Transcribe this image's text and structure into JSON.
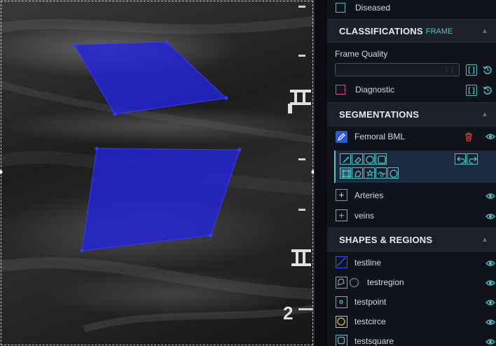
{
  "panel": {
    "top_item": {
      "label": "Diseased"
    },
    "classifications": {
      "title": "CLASSIFICATIONS",
      "tag": "FRAME",
      "frame_quality_label": "Frame Quality",
      "frame_quality_value": "",
      "diagnostic_label": "Diagnostic",
      "bracket_label": "[ ]"
    },
    "segmentations": {
      "title": "SEGMENTATIONS",
      "active_item": {
        "label": "Femoral BML"
      },
      "items": [
        {
          "label": "Arteries"
        },
        {
          "label": "veins"
        }
      ]
    },
    "shapes": {
      "title": "SHAPES & REGIONS",
      "items": [
        {
          "label": "testline",
          "type": "line"
        },
        {
          "label": "testregion",
          "type": "region"
        },
        {
          "label": "testpoint",
          "type": "point"
        },
        {
          "label": "testcirce",
          "type": "circle"
        },
        {
          "label": "testsquare",
          "type": "square"
        }
      ]
    }
  },
  "viewer": {
    "depth_marker": "2",
    "overlay_color": "#2323d8"
  },
  "colors": {
    "accent": "#4fc4c4",
    "delete": "#e0443c",
    "pink": "#d84d8a",
    "yellow": "#d9c24a"
  }
}
